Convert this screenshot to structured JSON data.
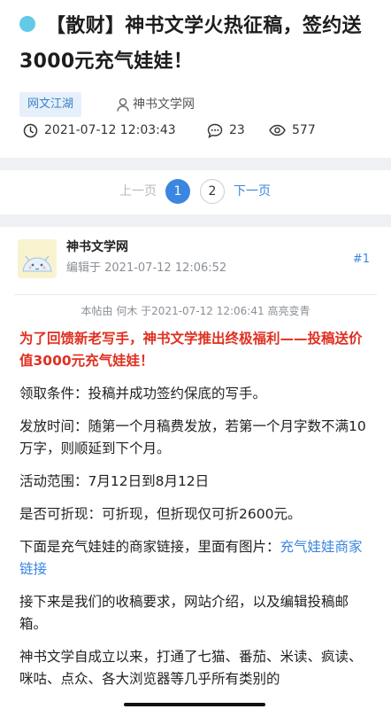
{
  "thread": {
    "title": "【散财】神书文学火热征稿，签约送3000元充气娃娃！",
    "forum_tag": "网文江湖",
    "author": "神书文学网",
    "datetime": "2021-07-12 12:03:43",
    "replies": "23",
    "views": "577",
    "title_dot_color": "#62c9e6"
  },
  "pager": {
    "prev_label": "上一页",
    "pages": [
      "1",
      "2"
    ],
    "current_page": "1",
    "next_label": "下一页",
    "accent": "#3a86e0"
  },
  "post": {
    "poster_name": "神书文学网",
    "edit_time": "编辑于 2021-07-12 12:06:52",
    "floor": "#1",
    "edit_note": "本帖由 何木 于2021-07-12 12:06:41 高亮变青",
    "headline": "为了回馈新老写手，神书文学推出终极福利——投稿送价值3000元充气娃娃！",
    "conditions": "领取条件：投稿并成功签约保底的写手。",
    "issue_time": "发放时间：随第一个月稿费发放，若第一个月字数不满10万字，则顺延到下个月。",
    "scope": "活动范围：7月12日到8月12日",
    "cashable": "是否可折现：可折现，但折现仅可折2600元。",
    "link_intro": "下面是充气娃娃的商家链接，里面有图片：",
    "link_text": "充气娃娃商家链接",
    "next_text": "接下来是我们的收稿要求，网站介绍，以及编辑投稿邮箱。",
    "intro_text": "神书文学自成立以来，打通了七猫、番茄、米读、疯读、咪咕、点众、各大浏览器等几乎所有类别的",
    "headline_color": "#e12f20"
  }
}
